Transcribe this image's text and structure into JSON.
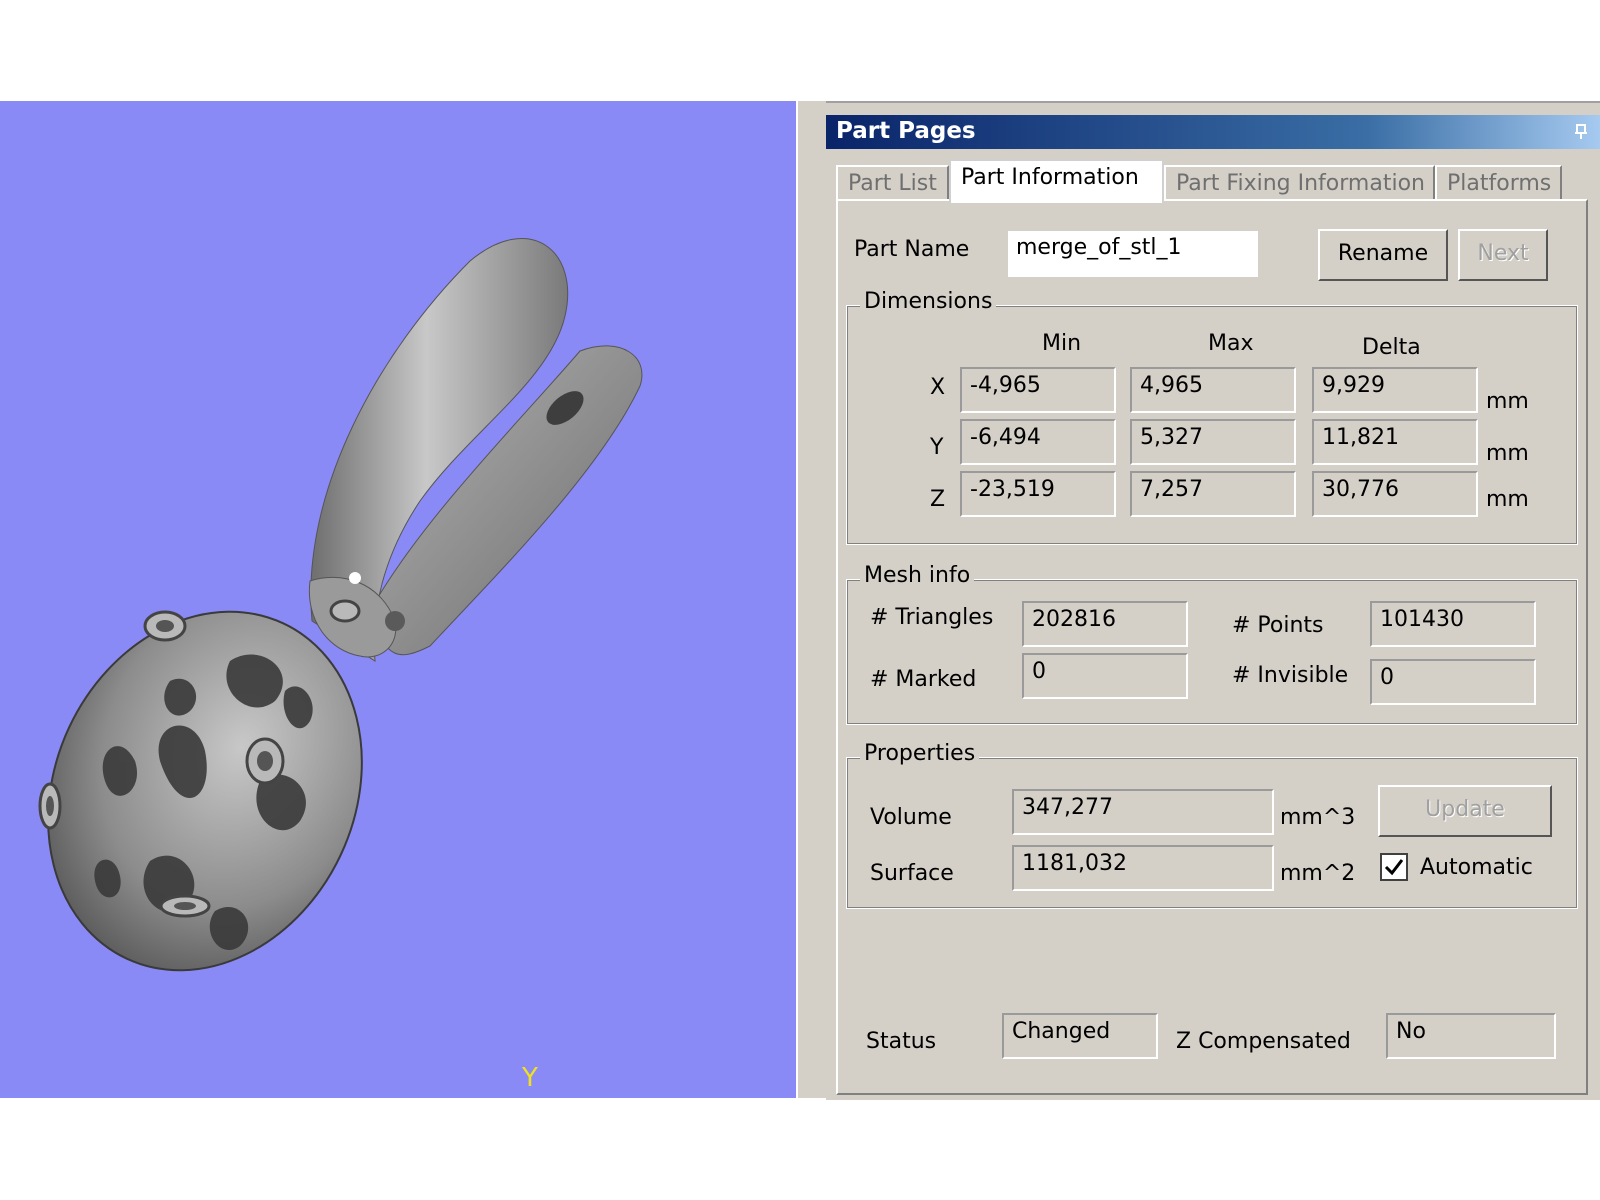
{
  "viewport": {
    "background": "#8a8af6",
    "axis_label": "Y"
  },
  "panel": {
    "title": "Part Pages",
    "pin_icon": "pin-icon",
    "tabs": [
      {
        "label": "Part List",
        "active": false
      },
      {
        "label": "Part Information",
        "active": true
      },
      {
        "label": "Part Fixing Information",
        "active": false
      },
      {
        "label": "Platforms",
        "active": false
      }
    ]
  },
  "part": {
    "name_label": "Part Name",
    "name_value": "merge_of_stl_1",
    "rename_label": "Rename",
    "next_label": "Next"
  },
  "dimensions": {
    "legend": "Dimensions",
    "headers": {
      "min": "Min",
      "max": "Max",
      "delta": "Delta"
    },
    "rows": [
      {
        "axis": "X",
        "min": "-4,965",
        "max": "4,965",
        "delta": "9,929",
        "unit": "mm"
      },
      {
        "axis": "Y",
        "min": "-6,494",
        "max": "5,327",
        "delta": "11,821",
        "unit": "mm"
      },
      {
        "axis": "Z",
        "min": "-23,519",
        "max": "7,257",
        "delta": "30,776",
        "unit": "mm"
      }
    ]
  },
  "mesh": {
    "legend": "Mesh info",
    "triangles_label": "# Triangles",
    "triangles_value": "202816",
    "points_label": "# Points",
    "points_value": "101430",
    "marked_label": "# Marked",
    "marked_value": "0",
    "invisible_label": "# Invisible",
    "invisible_value": "0"
  },
  "properties": {
    "legend": "Properties",
    "volume_label": "Volume",
    "volume_value": "347,277",
    "volume_unit": "mm^3",
    "surface_label": "Surface",
    "surface_value": "1181,032",
    "surface_unit": "mm^2",
    "update_label": "Update",
    "automatic_label": "Automatic",
    "automatic_checked": true
  },
  "status": {
    "label": "Status",
    "value": "Changed",
    "z_comp_label": "Z Compensated",
    "z_comp_value": "No"
  }
}
